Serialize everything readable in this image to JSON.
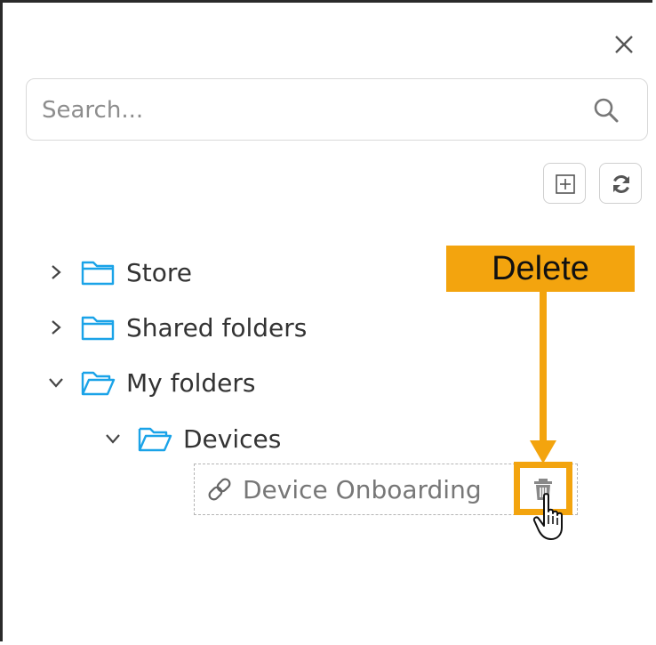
{
  "panel": {
    "close_icon": "close-icon"
  },
  "search": {
    "placeholder": "Search...",
    "icon": "search-icon"
  },
  "toolbar": {
    "add_icon": "add-square-icon",
    "refresh_icon": "refresh-icon"
  },
  "tree": {
    "items": [
      {
        "label": "Store",
        "expanded": false,
        "icon": "folder-icon"
      },
      {
        "label": "Shared folders",
        "expanded": false,
        "icon": "folder-icon"
      },
      {
        "label": "My folders",
        "expanded": true,
        "icon": "folder-open-icon"
      },
      {
        "label": "Devices",
        "expanded": true,
        "icon": "folder-open-icon"
      }
    ],
    "leaf": {
      "label": "Device Onboarding",
      "icon": "link-icon",
      "action_icon": "trash-icon"
    }
  },
  "annotation": {
    "label": "Delete",
    "color": "#f3a40e"
  },
  "colors": {
    "folder": "#1aa3e8",
    "text": "#333333",
    "muted": "#777777"
  }
}
